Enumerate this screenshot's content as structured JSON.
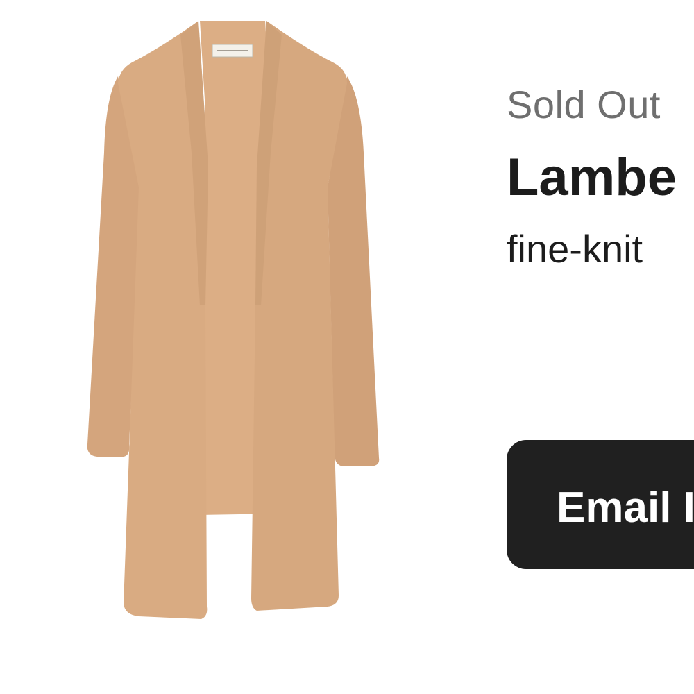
{
  "product": {
    "status": "Sold Out",
    "brand": "Lambe",
    "name": "fine-knit",
    "garment_color": "#d8ab84",
    "image_alt": "camel-open-front-cardigan"
  },
  "actions": {
    "email_label": "Email I",
    "button_color": "#202020"
  }
}
